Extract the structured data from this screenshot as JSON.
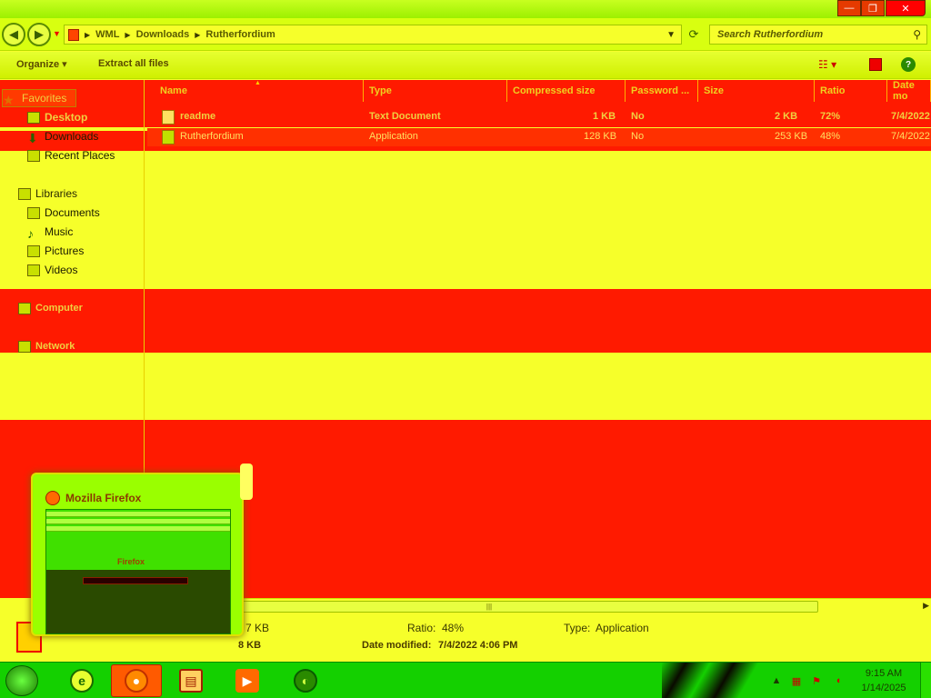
{
  "window": {
    "controls": {
      "minimize": "—",
      "maximize": "❐",
      "close": "✕"
    }
  },
  "address_bar": {
    "breadcrumbs": [
      "WML",
      "Downloads",
      "Rutherfordium"
    ],
    "search_placeholder": "Search Rutherfordium"
  },
  "toolbar": {
    "organize_label": "Organize ▾",
    "extract_label": "Extract all files"
  },
  "navigation": {
    "favorites": {
      "label": "Favorites",
      "items": [
        "Desktop",
        "Downloads",
        "Recent Places"
      ]
    },
    "libraries": {
      "label": "Libraries",
      "items": [
        "Documents",
        "Music",
        "Pictures",
        "Videos"
      ]
    },
    "computer_label": "Computer",
    "network_label": "Network"
  },
  "file_list": {
    "columns": [
      "Name",
      "Type",
      "Compressed size",
      "Password ...",
      "Size",
      "Ratio",
      "Date mo"
    ],
    "rows": [
      {
        "name": "readme",
        "type": "Text Document",
        "compressed_size": "1 KB",
        "password": "No",
        "size": "2 KB",
        "ratio": "72%",
        "date": "7/4/2022"
      },
      {
        "name": "Rutherfordium",
        "type": "Application",
        "compressed_size": "128 KB",
        "password": "No",
        "size": "253 KB",
        "ratio": "48%",
        "date": "7/4/2022"
      }
    ]
  },
  "details_pane": {
    "size_label": "7 KB",
    "compressed_label": "8 KB",
    "ratio_label": "Ratio:",
    "ratio_value": "48%",
    "type_label": "Type:",
    "type_value": "Application",
    "date_label": "Date modified:",
    "date_value": "7/4/2022 4:06 PM"
  },
  "taskbar": {
    "clock_time": "9:15 AM",
    "clock_date": "1/14/2025",
    "apps": [
      "internet-explorer",
      "firefox",
      "windows-explorer",
      "media-player",
      "other-app"
    ]
  },
  "firefox_preview": {
    "title": "Mozilla Firefox",
    "inner_logo": "Firefox"
  },
  "colors": {
    "red_band": "#ff1a00",
    "yellow_band": "#f6ff2a",
    "taskbar": "#14d000"
  }
}
